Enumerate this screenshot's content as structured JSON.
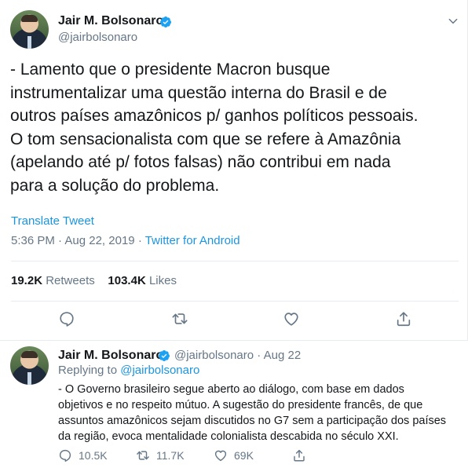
{
  "tweet": {
    "author_name": "Jair M. Bolsonaro",
    "author_handle": "@jairbolsonaro",
    "text_lines": [
      "- Lamento que o presidente Macron busque",
      "instrumentalizar uma questão interna do Brasil e de",
      "outros países amazônicos p/ ganhos políticos pessoais.",
      "O tom sensacionalista com que se refere à Amazônia",
      "(apelando até p/ fotos falsas) não contribui em nada",
      "para a solução do problema."
    ],
    "translate_label": "Translate Tweet",
    "time": "5:36 PM",
    "date": "Aug 22, 2019",
    "separator": "·",
    "source": "Twitter for Android",
    "retweets_count": "19.2K",
    "retweets_label": "Retweets",
    "likes_count": "103.4K",
    "likes_label": "Likes",
    "actions": [
      "reply-icon",
      "retweet-icon",
      "like-icon",
      "share-icon"
    ]
  },
  "reply": {
    "author_name": "Jair M. Bolsonaro",
    "author_handle": "@jairbolsonaro",
    "separator": "·",
    "date": "Aug 22",
    "replying_prefix": "Replying to",
    "replying_handle": "@jairbolsonaro",
    "text_lines": [
      "- O Governo brasileiro segue aberto ao diálogo, com base em dados",
      "objetivos e no respeito mútuo. A sugestão do presidente francês, de que",
      "assuntos amazônicos sejam discutidos no G7 sem a participação dos países",
      "da região, evoca mentalidade colonialista descabida no século XXI."
    ],
    "replies": "10.5K",
    "retweets": "11.7K",
    "likes": "69K"
  },
  "colors": {
    "accent": "#1b95e0",
    "verified": "#1da1f2",
    "muted": "#657786",
    "text": "#14171a",
    "border": "#e6ecf0"
  }
}
